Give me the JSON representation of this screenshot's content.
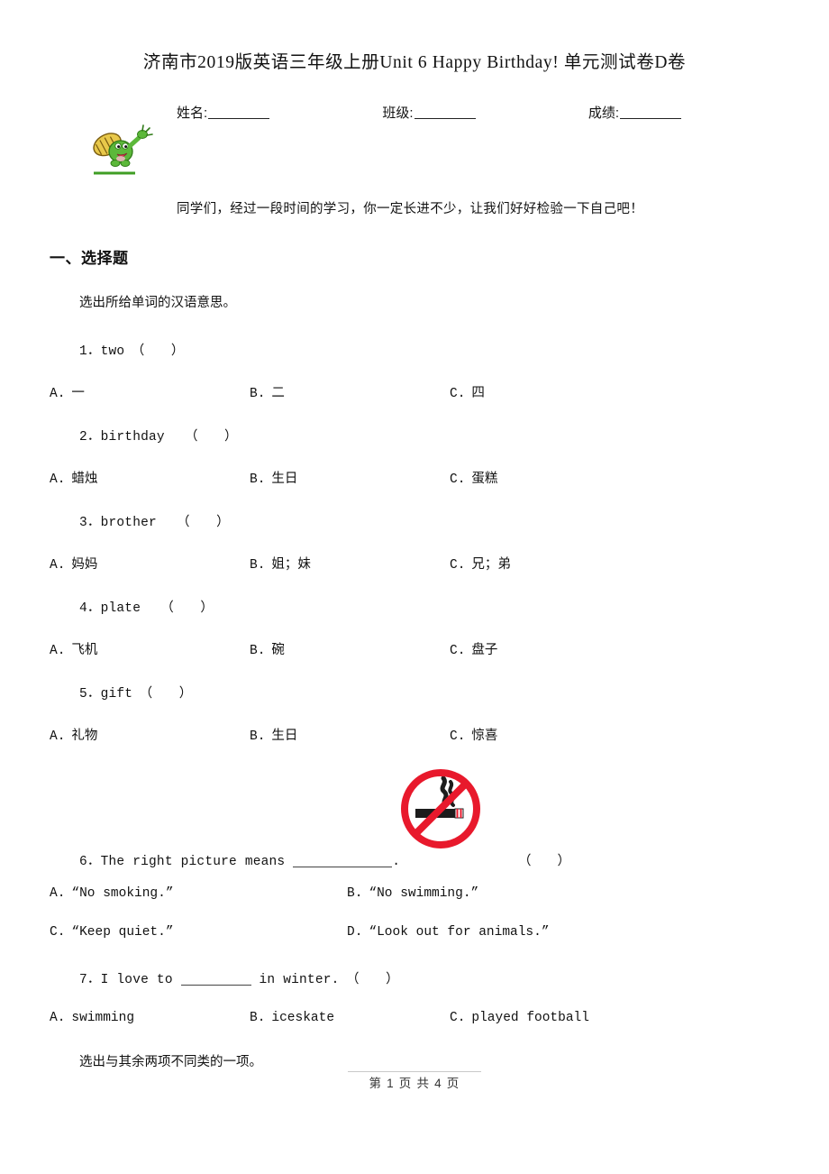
{
  "document": {
    "title": "济南市2019版英语三年级上册Unit 6 Happy Birthday! 单元测试卷D卷",
    "intro": "同学们，经过一段时间的学习，你一定长进不少，让我们好好检验一下自己吧！",
    "footer": "第 1 页 共 4 页"
  },
  "header_fields": {
    "name_label": "姓名:",
    "class_label": "班级:",
    "score_label": "成绩:"
  },
  "sections": [
    {
      "heading": "一、选择题",
      "directives": [
        "选出所给单词的汉语意思。",
        "选出与其余两项不同类的一项。"
      ]
    }
  ],
  "questions": [
    {
      "number": "1",
      "stem": "1．two　（　　）",
      "columns": 3,
      "options": [
        {
          "label": "A.",
          "text": "一"
        },
        {
          "label": "B.",
          "text": "二"
        },
        {
          "label": "C.",
          "text": "四"
        }
      ]
    },
    {
      "number": "2",
      "stem": "2．birthday　　（　　）",
      "columns": 3,
      "options": [
        {
          "label": "A.",
          "text": "蜡烛"
        },
        {
          "label": "B.",
          "text": "生日"
        },
        {
          "label": "C.",
          "text": "蛋糕"
        }
      ]
    },
    {
      "number": "3",
      "stem": "3．brother　　（　　）",
      "columns": 3,
      "options": [
        {
          "label": "A.",
          "text": "妈妈"
        },
        {
          "label": "B.",
          "text": "姐；妹"
        },
        {
          "label": "C.",
          "text": "兄；弟"
        }
      ]
    },
    {
      "number": "4",
      "stem": "4．plate　　（　　）",
      "columns": 3,
      "options": [
        {
          "label": "A.",
          "text": "飞机"
        },
        {
          "label": "B.",
          "text": "碗"
        },
        {
          "label": "C.",
          "text": "盘子"
        }
      ]
    },
    {
      "number": "5",
      "stem": "5．gift　（　　）",
      "columns": 3,
      "options": [
        {
          "label": "A.",
          "text": "礼物"
        },
        {
          "label": "B.",
          "text": "生日"
        },
        {
          "label": "C.",
          "text": "惊喜"
        }
      ]
    },
    {
      "number": "6",
      "stem_before_blank": "6．The right picture means ",
      "stem_after_blank": ".",
      "stem_paren": "（　　）",
      "columns": 2,
      "options": [
        {
          "label": "A.",
          "text": "“No smoking.”"
        },
        {
          "label": "B.",
          "text": "“No swimming.”"
        },
        {
          "label": "C.",
          "text": "“Keep quiet.”"
        },
        {
          "label": "D.",
          "text": "“Look out for animals.”"
        }
      ]
    },
    {
      "number": "7",
      "stem_before_blank": "7．I love to ",
      "stem_after_blank": " in winter.　（　　）",
      "columns": 3,
      "options": [
        {
          "label": "A.",
          "text": "swimming"
        },
        {
          "label": "B.",
          "text": "iceskate"
        },
        {
          "label": "C.",
          "text": "played football"
        }
      ]
    }
  ],
  "images": {
    "mascot": "cartoon-turtle-mascot",
    "no_smoking_sign": "no-smoking-sign"
  },
  "colors": {
    "sign_red": "#e8192c",
    "cigarette_dark": "#1c1c1c",
    "mascot_green": "#5cb83a",
    "mascot_shell": "#e8c84a",
    "text": "#111111"
  }
}
